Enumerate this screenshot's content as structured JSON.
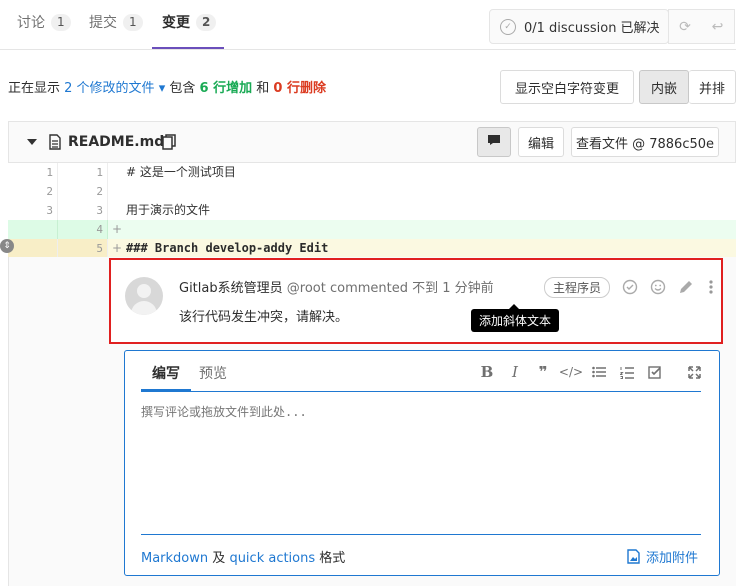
{
  "tabs": [
    {
      "label": "讨论",
      "count": "1"
    },
    {
      "label": "提交",
      "count": "1"
    },
    {
      "label": "变更",
      "count": "2"
    }
  ],
  "discussion": {
    "status": "0/1 discussion 已解决"
  },
  "info": {
    "prefix": "正在显示",
    "files": "2 个修改的文件",
    "contains": "包含",
    "additions": "6 行增加",
    "and": "和",
    "deletions": "0 行删除"
  },
  "view_buttons": {
    "whitespace": "显示空白字符变更",
    "inline": "内嵌",
    "parallel": "并排"
  },
  "file": {
    "name": "README.md",
    "edit": "编辑",
    "view": "查看文件 @ 7886c50e"
  },
  "diff_lines": [
    {
      "old": "1",
      "new": "1",
      "text": "# 这是一个测试项目",
      "type": "ctx"
    },
    {
      "old": "2",
      "new": "2",
      "text": "",
      "type": "ctx"
    },
    {
      "old": "3",
      "new": "3",
      "text": "用于演示的文件",
      "type": "ctx"
    },
    {
      "old": "",
      "new": "4",
      "text": "",
      "type": "add"
    },
    {
      "old": "",
      "new": "5",
      "text": "### Branch develop-addy Edit",
      "type": "add-hl"
    }
  ],
  "diff_plus": "+",
  "note": {
    "author": "Gitlab系统管理员",
    "meta": "@root commented 不到 1 分钟前",
    "role": "主程序员",
    "body": "该行代码发生冲突，请解决。"
  },
  "tooltip": "添加斜体文本",
  "editor": {
    "tab_write": "编写",
    "tab_preview": "预览",
    "placeholder": "撰写评论或拖放文件到此处...",
    "markdown": "Markdown",
    "and": "及",
    "quick_actions": "quick actions",
    "format": "格式",
    "attach": "添加附件"
  },
  "colors": {
    "accent": "#1f78d1",
    "tab_active": "#6b4fbb",
    "addition": "#1aaa55",
    "deletion": "#db3b21",
    "highlight_border": "#e02020"
  }
}
